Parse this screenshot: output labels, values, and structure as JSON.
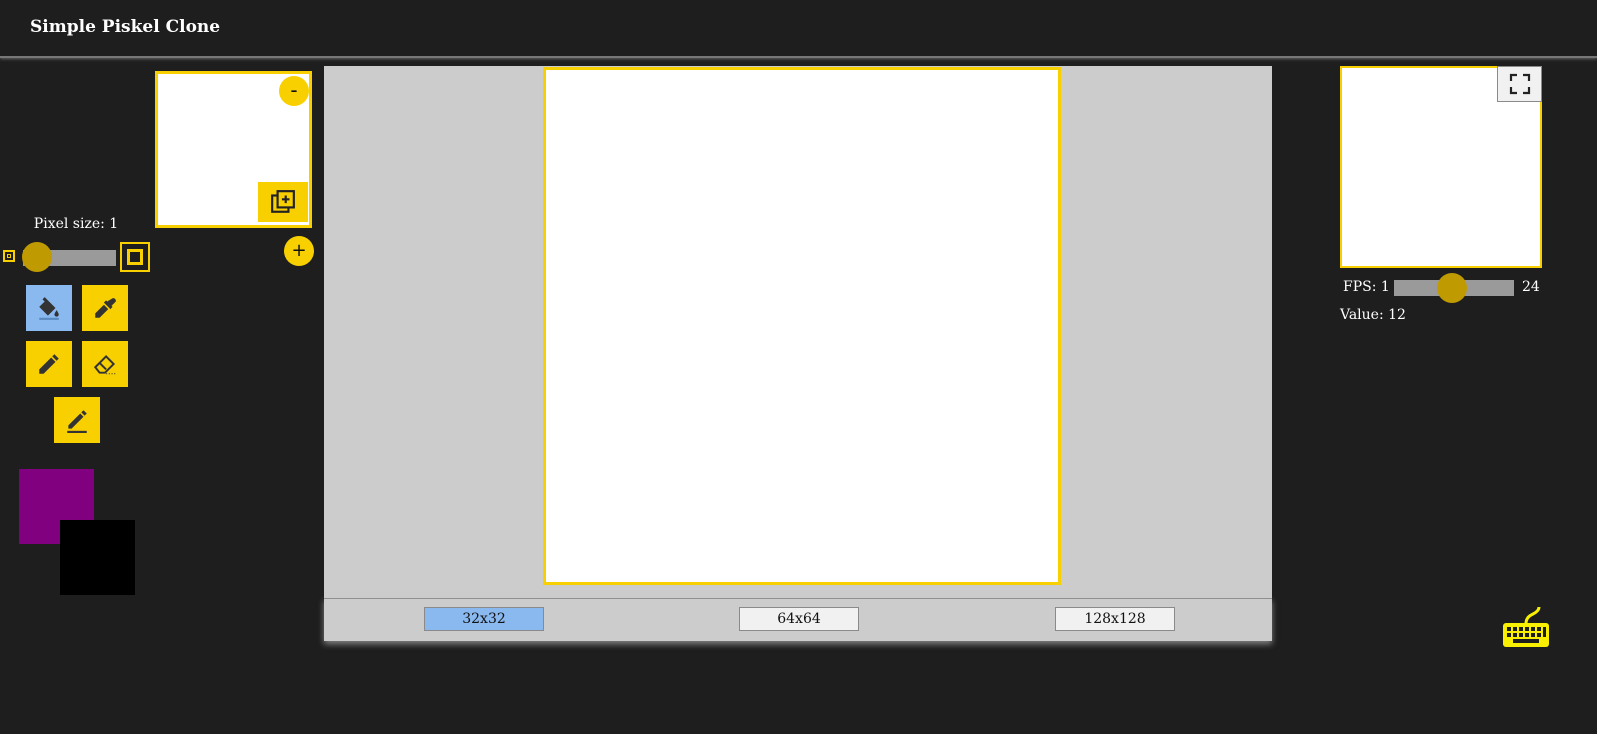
{
  "app": {
    "title": "Simple Piskel Clone"
  },
  "pixel_size": {
    "label": "Pixel size: 1",
    "value": 1
  },
  "tools": {
    "bucket": "paint-bucket-icon",
    "picker": "eyedropper-icon",
    "pencil": "pencil-icon",
    "eraser": "eraser-icon",
    "stroke": "stroke-pen-icon",
    "active": "bucket"
  },
  "colors": {
    "primary": "#800080",
    "secondary": "#000000"
  },
  "frames": {
    "delete_label": "-",
    "add_label": "+"
  },
  "canvas_sizes": {
    "s32": "32x32",
    "s64": "64x64",
    "s128": "128x128",
    "selected": "32x32"
  },
  "preview": {
    "fps_label": "FPS: 1",
    "fps_max": "24",
    "value_label": "Value: 12",
    "fps_value": 12
  },
  "accent_color": "#f8d000"
}
